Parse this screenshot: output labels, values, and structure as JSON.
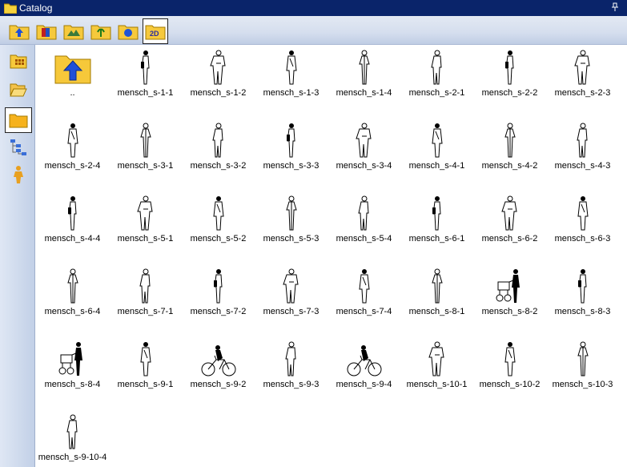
{
  "window": {
    "title": "Catalog"
  },
  "toolbar": {
    "buttons": [
      {
        "name": "up-folder-icon"
      },
      {
        "name": "catalog-book-icon"
      },
      {
        "name": "terrain-folder-icon"
      },
      {
        "name": "plant-folder-icon"
      },
      {
        "name": "sphere-folder-icon"
      },
      {
        "name": "2d-folder-icon",
        "label": "2D",
        "active": true
      }
    ]
  },
  "sidebar": {
    "buttons": [
      {
        "name": "grid-view-icon"
      },
      {
        "name": "open-folder-icon"
      },
      {
        "name": "folder-icon",
        "active": true
      },
      {
        "name": "tree-view-icon"
      },
      {
        "name": "person-icon"
      }
    ]
  },
  "items": [
    {
      "label": "..",
      "type": "up"
    },
    {
      "label": "mensch_s-1-1"
    },
    {
      "label": "mensch_s-1-2"
    },
    {
      "label": "mensch_s-1-3"
    },
    {
      "label": "mensch_s-1-4"
    },
    {
      "label": "mensch_s-2-1"
    },
    {
      "label": "mensch_s-2-2"
    },
    {
      "label": "mensch_s-2-3"
    },
    {
      "label": "mensch_s-2-4"
    },
    {
      "label": "mensch_s-3-1"
    },
    {
      "label": "mensch_s-3-2"
    },
    {
      "label": "mensch_s-3-3"
    },
    {
      "label": "mensch_s-3-4"
    },
    {
      "label": "mensch_s-4-1"
    },
    {
      "label": "mensch_s-4-2"
    },
    {
      "label": "mensch_s-4-3"
    },
    {
      "label": "mensch_s-4-4"
    },
    {
      "label": "mensch_s-5-1"
    },
    {
      "label": "mensch_s-5-2"
    },
    {
      "label": "mensch_s-5-3"
    },
    {
      "label": "mensch_s-5-4"
    },
    {
      "label": "mensch_s-6-1"
    },
    {
      "label": "mensch_s-6-2"
    },
    {
      "label": "mensch_s-6-3"
    },
    {
      "label": "mensch_s-6-4"
    },
    {
      "label": "mensch_s-7-1"
    },
    {
      "label": "mensch_s-7-2"
    },
    {
      "label": "mensch_s-7-3"
    },
    {
      "label": "mensch_s-7-4"
    },
    {
      "label": "mensch_s-8-1"
    },
    {
      "label": "mensch_s-8-2"
    },
    {
      "label": "mensch_s-8-3"
    },
    {
      "label": "mensch_s-8-4"
    },
    {
      "label": "mensch_s-9-1"
    },
    {
      "label": "mensch_s-9-2"
    },
    {
      "label": "mensch_s-9-3"
    },
    {
      "label": "mensch_s-9-4"
    },
    {
      "label": "mensch_s-10-1"
    },
    {
      "label": "mensch_s-10-2"
    },
    {
      "label": "mensch_s-10-3"
    },
    {
      "label": "mensch_s-9-10-4"
    }
  ]
}
